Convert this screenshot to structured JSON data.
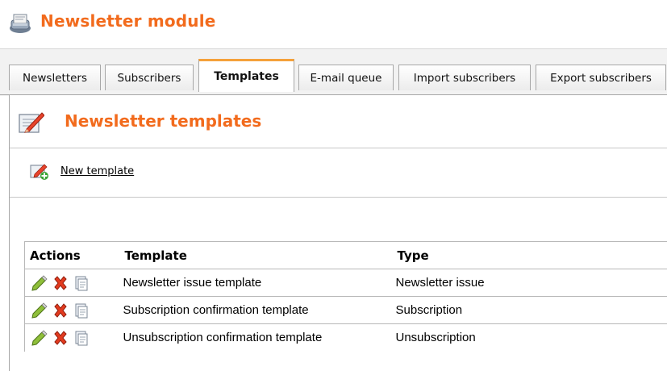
{
  "module": {
    "title": "Newsletter module",
    "icon": "newsletter-module-icon",
    "accent_color": "#f26b1d"
  },
  "tabs": [
    {
      "label": "Newsletters",
      "active": false
    },
    {
      "label": "Subscribers",
      "active": false
    },
    {
      "label": "Templates",
      "active": true
    },
    {
      "label": "E-mail queue",
      "active": false
    },
    {
      "label": "Import subscribers",
      "active": false
    },
    {
      "label": "Export subscribers",
      "active": false
    }
  ],
  "section": {
    "title": "Newsletter templates",
    "icon": "templates-edit-icon"
  },
  "actions_bar": {
    "new_template_label": "New template",
    "icon": "new-template-icon"
  },
  "grid": {
    "columns": [
      "Actions",
      "Template",
      "Type"
    ],
    "row_actions": [
      "edit-icon",
      "delete-icon",
      "clone-icon"
    ],
    "rows": [
      {
        "template": "Newsletter issue template",
        "type": "Newsletter issue"
      },
      {
        "template": "Subscription confirmation template",
        "type": "Subscription"
      },
      {
        "template": "Unsubscription confirmation template",
        "type": "Unsubscription"
      }
    ]
  }
}
